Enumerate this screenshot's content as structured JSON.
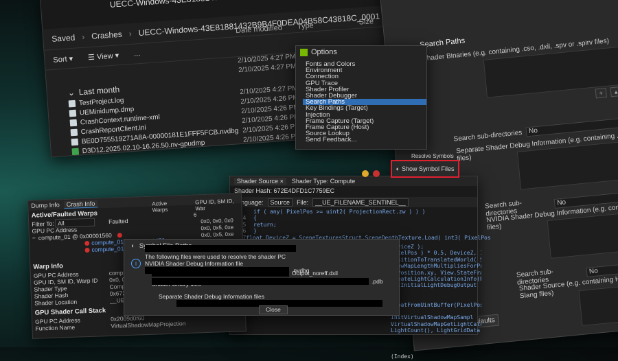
{
  "explorer": {
    "title": "UECC-Windows-43E81881432B9B4F0DEA04B58C43818C_0001",
    "breadcrumb": [
      "Saved",
      "Crashes",
      "UECC-Windows-43E81881432B9B4F0DEA04B58C43818C_0001"
    ],
    "commands": {
      "sort": "Sort",
      "view": "View",
      "more": "..."
    },
    "columns": [
      "Date modified",
      "Type",
      "Size"
    ],
    "groups": {
      "last_month": "Last month"
    },
    "files": [
      {
        "name": "",
        "date": "2/10/2025 4:27 PM",
        "icon": "file-icon"
      },
      {
        "name": "",
        "date": "2/10/2025 4:27 PM",
        "icon": "file-icon"
      },
      {
        "name": "TestProject.log",
        "date": "2/10/2025 4:27 PM",
        "icon": "file-icon"
      },
      {
        "name": "UEMinidump.dmp",
        "date": "2/10/2025 4:26 PM",
        "icon": "file-icon"
      },
      {
        "name": "CrashContext.runtime-xml",
        "date": "2/10/2025 4:26 PM",
        "icon": "file-icon"
      },
      {
        "name": "CrashReportClient.ini",
        "date": "2/10/2025 4:26 PM",
        "icon": "file-icon"
      },
      {
        "name": "BE0D755519271A8A-00000181E1FFF5FCB.nvdbg",
        "date": "2/10/2025 4:26 PM",
        "icon": "file-icon"
      },
      {
        "name": "D3D12.2025.02.10-16.26.50.nv-gpudmp",
        "date": "2/10/2025 4:26 PM",
        "icon": "gpudump-icon"
      }
    ]
  },
  "options": {
    "title": "Options",
    "items": [
      "Fonts and Colors",
      "Environment",
      "Connection",
      "GPU Trace",
      "Shader Profiler",
      "Shader Debugger",
      "Search Paths",
      "Key Bindings (Target)",
      "Injection",
      "Frame Capture (Target)",
      "Frame Capture (Host)",
      "Source Lookup",
      "Send Feedback..."
    ],
    "selected_index": 6
  },
  "search_paths": {
    "title": "Search Paths",
    "shader_binaries_label": "Shader Binaries (e.g. containing .cso, .dxil, .spv or .spirv files)",
    "separate_debug_label": "Separate Shader Debug Information (e.g. containing .lld or .pdb files)",
    "nvidia_debug_label": "NVIDIA Shader Debug Information (e.g. containing .nvdbg files)",
    "shader_source_label": "Shader Source (e.g. containing HLSL, GLSL or Slang files)",
    "search_subdirs_label": "Search sub-directories",
    "search_subdirs_value": "No",
    "restore_defaults": "Restore Defaults"
  },
  "shader": {
    "tab_source": "Shader Source",
    "tab_type": "Shader Type: Compute",
    "hash": "Shader Hash: 672E4DFD1C7759EC",
    "language_label": "Language:",
    "language_value": "Source",
    "file_label": "File:",
    "file_value": "__UE_FILENAME_SENTINEL__",
    "show_symbol_files": "Show Symbol Files",
    "resolve_symbols": "Resolve Symbols",
    "lines": [
      {
        "ln": "",
        "code": "if ( any( PixelPos >= uint2( ProjectionRect.zw ) ) )"
      },
      {
        "ln": "4104",
        "code": "{"
      },
      {
        "ln": "4105",
        "code": "    return;"
      },
      {
        "ln": "4106",
        "code": "}"
      },
      {
        "ln": "4107",
        "code": "float DeviceZ = SceneTexturesStruct.SceneDepthTexture.Load( int3( PixelPos"
      },
      {
        "ln": "4108",
        "code": ""
      }
    ],
    "lines_right": [
      "DeviceZ );",
      "PixelPos ) * 0.5, DeviceZ, 1.0",
      "PositionToTranslatedWorld( SvPos",
      "ViewMapLengthMultipliesForProjec",
      "SvPosition.xy, View.StateFrameI",
      "CreateLightCalculationInfo(Pix",
      "GetInitialLightDebugOutput",
      "",
      "",
      "FloatFromUintBuffer(PixelPos);",
      "",
      "InitVirtualShadowMapSampl",
      "VirtualShadowMapGetLightCalcula",
      "LightCount(), LightGridData.Cu",
      "",
      "",
      "",
      "(Index)"
    ]
  },
  "debug": {
    "tabs": [
      "Dump Info",
      "Crash Info"
    ],
    "active_tab": 1,
    "section_warps": "Active/Faulted Warps",
    "filter_label": "Filter To:",
    "filter_value": "All",
    "col_faulted": "Faulted",
    "col_active": "Active Warps",
    "col_gpu": "GPU ID, SM ID, War",
    "gpu_pc_label": "GPU PC Address",
    "gpu_pc_row": "compute_01 @ 0x00001560",
    "warp_rows": [
      "compute_01 @ 0x00001470",
      "compute_01 @ 0x00001470"
    ],
    "active_count": "6",
    "gpu_vals": [
      "0x0, 0x0, 0x0",
      "0x0, 0x5, 0xe",
      "0x0, 0x5, 0xe"
    ],
    "warp_info": "Warp Info",
    "warp_fields": [
      {
        "k": "GPU PC Address",
        "v": "compute_01 @ 0x00001560"
      },
      {
        "k": "GPU ID, SM ID, Warp ID",
        "v": "0x0, 0x0, 0x0"
      },
      {
        "k": "Shader Type",
        "v": "Compute"
      },
      {
        "k": "Shader Hash",
        "v": "0x672ed4fd1c7759ec"
      },
      {
        "k": "Shader Location",
        "v": "__UE_FILENAM"
      }
    ],
    "call_stack": "GPU Shader Call Stack",
    "cs_gpu_pc": "GPU PC Address",
    "cs_gpu_pc_val": "0x2009d0f60",
    "cs_function": "Function Name",
    "cs_function_val": "VirtualShadowMapProjection"
  },
  "symbol_dialog": {
    "title": "Symbol File Paths",
    "line1": "The following files were used to resolve the shader PC",
    "nvidia_label": "NVIDIA Shader Debug Information file",
    "nvdbg_suffix": ".nvdbg",
    "binary_label": "Shader Binary files",
    "dxil_suffix": "Output_noreff.dxil",
    "pdb_suffix": ".pdb",
    "separate_label": "Separate Shader Debug Information files",
    "close": "Close"
  }
}
